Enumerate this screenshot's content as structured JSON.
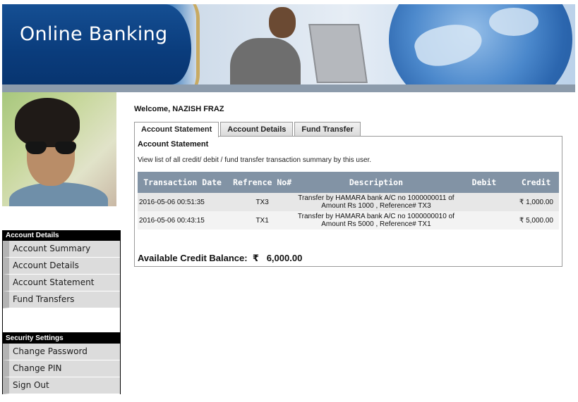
{
  "header": {
    "title": "Online Banking"
  },
  "welcome": {
    "text": "Welcome, NAZISH FRAZ"
  },
  "tabs": [
    {
      "label": "Account Statement",
      "active": true
    },
    {
      "label": "Account Details",
      "active": false
    },
    {
      "label": "Fund Transfer",
      "active": false
    }
  ],
  "panel": {
    "title": "Account Statement",
    "description": "View list of all credit/ debit / fund transfer transaction summary by this user."
  },
  "table": {
    "headers": [
      "Transaction Date",
      "Refrence No#",
      "Description",
      "Debit",
      "Credit"
    ],
    "rows": [
      {
        "date": "2016-05-06 00:51:35",
        "ref": "TX3",
        "description": "Transfer by HAMARA bank A/C no 1000000011 of Amount Rs 1000 , Reference# TX3",
        "debit": "",
        "credit": "₹ 1,000.00"
      },
      {
        "date": "2016-05-06 00:43:15",
        "ref": "TX1",
        "description": "Transfer by HAMARA bank A/C no 1000000010 of Amount Rs 5000 , Reference# TX1",
        "debit": "",
        "credit": "₹ 5,000.00"
      }
    ]
  },
  "balance": {
    "label": "Available Credit Balance:",
    "currency": "₹",
    "amount": "6,000.00"
  },
  "sidebar": {
    "account_section": {
      "heading": "Account Details",
      "items": [
        "Account Summary",
        "Account Details",
        "Account Statement",
        "Fund Transfers"
      ]
    },
    "security_section": {
      "heading": "Security Settings",
      "items": [
        "Change Password",
        "Change PIN",
        "Sign Out"
      ]
    }
  },
  "colors": {
    "banner_blue": "#0a3c7c",
    "table_header": "#8293a5",
    "menu_item_bg": "#dcdcdc",
    "menu_heading_bg": "#000000"
  }
}
